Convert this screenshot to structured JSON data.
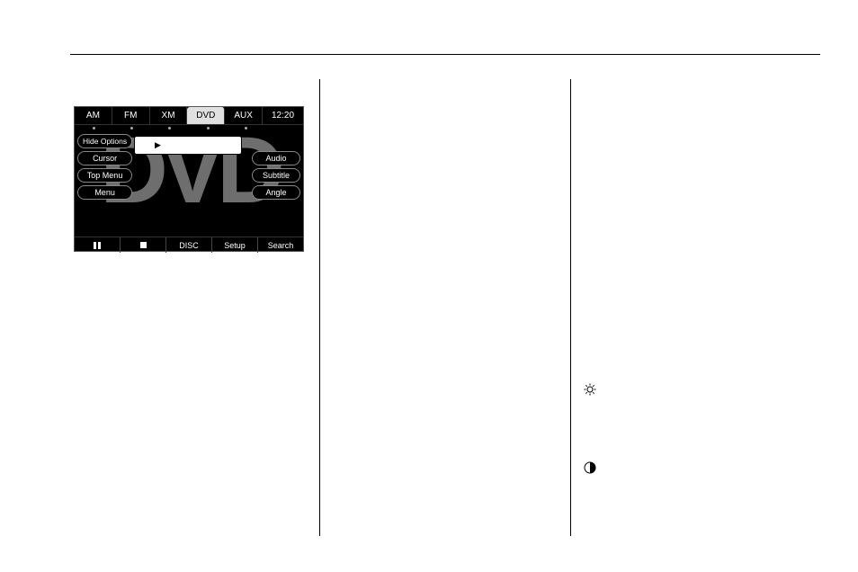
{
  "dvd_screen": {
    "tabs": [
      "AM",
      "FM",
      "XM",
      "DVD",
      "AUX"
    ],
    "active_tab_index": 3,
    "clock": "12:20",
    "bg_text": "DVD",
    "left_buttons": [
      "Hide Options",
      "Cursor",
      "Top Menu",
      "Menu"
    ],
    "right_buttons": [
      "Audio",
      "Subtitle",
      "Angle"
    ],
    "cursor_field": "▶",
    "bottom_labels": {
      "disc": "DISC",
      "setup": "Setup",
      "search": "Search"
    }
  },
  "icons": {
    "sun": "brightness-icon",
    "contrast": "contrast-icon"
  }
}
